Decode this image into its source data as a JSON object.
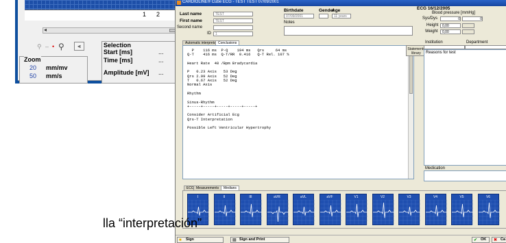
{
  "background_window": {
    "ticks": [
      "1",
      "2"
    ],
    "zoom": {
      "title": "Zoom",
      "row1_value": "20",
      "row1_unit": "mm/mv",
      "row2_value": "50",
      "row2_unit": "mm/s"
    },
    "selection": {
      "title": "Selection",
      "start_label": "Start [ms]",
      "start_value": "...",
      "time_label": "Time [ms]",
      "time_value": "...",
      "amplitude_label": "Amplitude [mV]",
      "amplitude_value": "..."
    }
  },
  "dialog": {
    "title": "CARDIOLINE®   Cube ECG  -  TEST TEST 07/09/2001",
    "patient": {
      "last_name_label": "Last name",
      "last_name_value": "TEST",
      "first_name_label": "First name",
      "first_name_value": "TEST",
      "second_name_label": "Second name",
      "id_label": "ID",
      "id_value": "1",
      "birthdate_label": "Birthdate",
      "birthdate_value": "07/09/2001",
      "gender_label": "Gender",
      "age_label": "Age",
      "age_value": "11 years",
      "notes_label": "Notes"
    },
    "ecg_info": {
      "title": "ECG 16/12/2005",
      "bp_label": "Blood pressure [mmHg]",
      "sys_dys_label": "Sys/Dys",
      "sys_value": "0",
      "dys_value": "0",
      "height_label": "Height",
      "height_value": "0,00",
      "weight_label": "Weight",
      "weight_value": "0,00"
    },
    "tabs_top": [
      "Automatic interpretation",
      "Conclusions"
    ],
    "statements_button": "Statements library",
    "institution_label": "Institution",
    "department_label": "Department",
    "reasons_label": "Reasons for test",
    "medication_label": "Medication",
    "interpretation_lines": [
      "  P    116 ms  P-Q    194 ms   Qrs     64 ms",
      "Q-T    416 ms  Q-T/RR  0.416   Q-T Rel. 107 %",
      "",
      "Heart Rate  48 /Bpm Bradycardia",
      "",
      "P   0.23 Axis   53 Deg",
      "Qrs 2.99 Axis   52 Deg",
      "T   0.67 Axis   52 Deg",
      "Normal Axis",
      "",
      "Rhythm",
      "",
      "Sinus-Rhythm",
      "+-----+-----+-----+-----+-----+",
      "",
      "Consider Artificial Ecg",
      "Qrs-T Interpretation",
      "",
      "Possible Left Ventricular Hypertrophy"
    ],
    "tabs_bottom": [
      "ECG",
      "Measurements",
      "Medians"
    ],
    "leads": [
      "I",
      "II",
      "III",
      "aVR",
      "aVL",
      "aVF",
      "V1",
      "V2",
      "V3",
      "V4",
      "V5",
      "V6"
    ],
    "bottom_buttons": {
      "sign": "Sign",
      "sign_print": "Sign and Print",
      "ok": "OK",
      "cancel": "Ca"
    }
  },
  "caption": "lla “interpretación”"
}
